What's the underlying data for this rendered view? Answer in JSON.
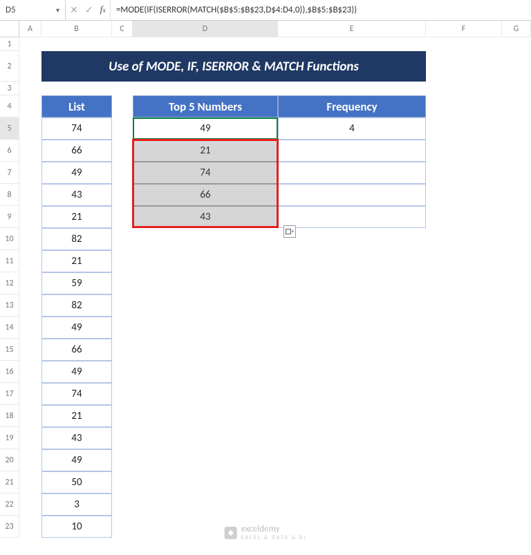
{
  "active_cell": "D5",
  "formula": "=MODE(IF(ISERROR(MATCH($B$5:$B$23,D$4:D4,0)),$B$5:$B$23))",
  "columns": [
    "A",
    "B",
    "C",
    "D",
    "E",
    "F",
    "G"
  ],
  "rows": [
    "1",
    "2",
    "3",
    "4",
    "5",
    "6",
    "7",
    "8",
    "9",
    "10",
    "11",
    "12",
    "13",
    "14",
    "15",
    "16",
    "17",
    "18",
    "19",
    "20",
    "21",
    "22",
    "23"
  ],
  "title": "Use of MODE, IF, ISERROR & MATCH Functions",
  "headers": {
    "list": "List",
    "top5": "Top 5 Numbers",
    "freq": "Frequency"
  },
  "list_values": [
    "74",
    "66",
    "49",
    "43",
    "21",
    "82",
    "21",
    "59",
    "82",
    "49",
    "66",
    "49",
    "74",
    "21",
    "43",
    "49",
    "50",
    "3",
    "10"
  ],
  "top5_values": [
    "49",
    "21",
    "74",
    "66",
    "43"
  ],
  "freq_values": [
    "4"
  ],
  "watermark": {
    "brand": "exceldemy",
    "tag": "EXCEL & DATA & BI"
  },
  "chart_data": {
    "type": "table",
    "title": "Use of MODE, IF, ISERROR & MATCH Functions",
    "columns": [
      "List",
      "Top 5 Numbers",
      "Frequency"
    ],
    "list": [
      74,
      66,
      49,
      43,
      21,
      82,
      21,
      59,
      82,
      49,
      66,
      49,
      74,
      21,
      43,
      49,
      50,
      3,
      10
    ],
    "top5": [
      49,
      21,
      74,
      66,
      43
    ],
    "frequency": [
      4
    ]
  }
}
